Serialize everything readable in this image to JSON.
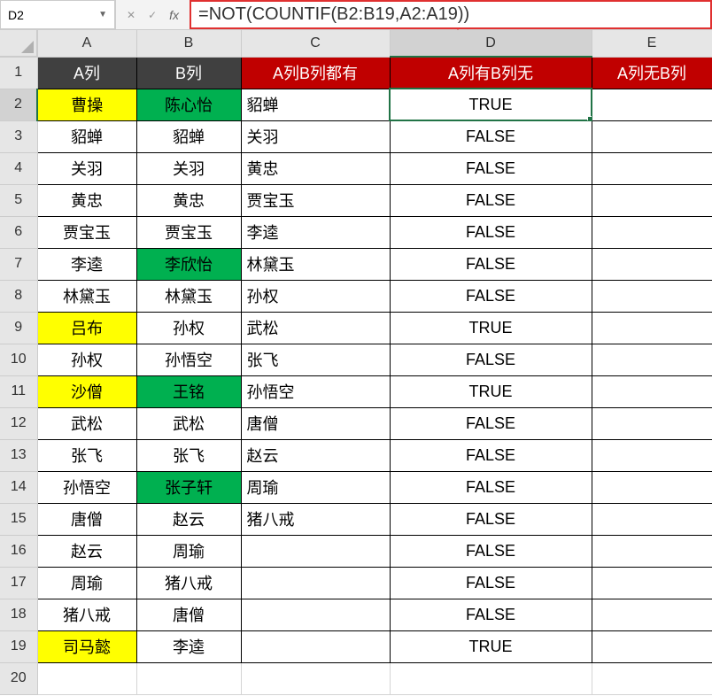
{
  "nameBox": "D2",
  "formula": "=NOT(COUNTIF(B2:B19,A2:A19))",
  "colHeaders": [
    "A",
    "B",
    "C",
    "D",
    "E"
  ],
  "activeCol": "D",
  "activeRow": 2,
  "fx": "fx",
  "headerRow": {
    "A": "A列",
    "B": "B列",
    "C": "A列B列都有",
    "D": "A列有B列无",
    "E": "A列无B列"
  },
  "rows": [
    {
      "r": 2,
      "A": {
        "v": "曹操",
        "cls": "yellow"
      },
      "B": {
        "v": "陈心怡",
        "cls": "green"
      },
      "C": {
        "v": "貂蝉"
      },
      "D": {
        "v": "TRUE"
      }
    },
    {
      "r": 3,
      "A": {
        "v": "貂蝉",
        "cls": "plain-center"
      },
      "B": {
        "v": "貂蝉",
        "cls": "plain-center"
      },
      "C": {
        "v": "关羽"
      },
      "D": {
        "v": "FALSE"
      }
    },
    {
      "r": 4,
      "A": {
        "v": "关羽",
        "cls": "plain-center"
      },
      "B": {
        "v": "关羽",
        "cls": "plain-center"
      },
      "C": {
        "v": "黄忠"
      },
      "D": {
        "v": "FALSE"
      }
    },
    {
      "r": 5,
      "A": {
        "v": "黄忠",
        "cls": "plain-center"
      },
      "B": {
        "v": "黄忠",
        "cls": "plain-center"
      },
      "C": {
        "v": "贾宝玉"
      },
      "D": {
        "v": "FALSE"
      }
    },
    {
      "r": 6,
      "A": {
        "v": "贾宝玉",
        "cls": "plain-center"
      },
      "B": {
        "v": "贾宝玉",
        "cls": "plain-center"
      },
      "C": {
        "v": "李逵"
      },
      "D": {
        "v": "FALSE"
      }
    },
    {
      "r": 7,
      "A": {
        "v": "李逵",
        "cls": "plain-center"
      },
      "B": {
        "v": "李欣怡",
        "cls": "green"
      },
      "C": {
        "v": "林黛玉"
      },
      "D": {
        "v": "FALSE"
      }
    },
    {
      "r": 8,
      "A": {
        "v": "林黛玉",
        "cls": "plain-center"
      },
      "B": {
        "v": "林黛玉",
        "cls": "plain-center"
      },
      "C": {
        "v": "孙权"
      },
      "D": {
        "v": "FALSE"
      }
    },
    {
      "r": 9,
      "A": {
        "v": "吕布",
        "cls": "yellow"
      },
      "B": {
        "v": "孙权",
        "cls": "plain-center"
      },
      "C": {
        "v": "武松"
      },
      "D": {
        "v": "TRUE"
      }
    },
    {
      "r": 10,
      "A": {
        "v": "孙权",
        "cls": "plain-center"
      },
      "B": {
        "v": "孙悟空",
        "cls": "plain-center"
      },
      "C": {
        "v": "张飞"
      },
      "D": {
        "v": "FALSE"
      }
    },
    {
      "r": 11,
      "A": {
        "v": "沙僧",
        "cls": "yellow"
      },
      "B": {
        "v": "王铭",
        "cls": "green"
      },
      "C": {
        "v": "孙悟空"
      },
      "D": {
        "v": "TRUE"
      }
    },
    {
      "r": 12,
      "A": {
        "v": "武松",
        "cls": "plain-center"
      },
      "B": {
        "v": "武松",
        "cls": "plain-center"
      },
      "C": {
        "v": "唐僧"
      },
      "D": {
        "v": "FALSE"
      }
    },
    {
      "r": 13,
      "A": {
        "v": "张飞",
        "cls": "plain-center"
      },
      "B": {
        "v": "张飞",
        "cls": "plain-center"
      },
      "C": {
        "v": "赵云"
      },
      "D": {
        "v": "FALSE"
      }
    },
    {
      "r": 14,
      "A": {
        "v": "孙悟空",
        "cls": "plain-center"
      },
      "B": {
        "v": "张子轩",
        "cls": "green"
      },
      "C": {
        "v": "周瑜"
      },
      "D": {
        "v": "FALSE"
      }
    },
    {
      "r": 15,
      "A": {
        "v": "唐僧",
        "cls": "plain-center"
      },
      "B": {
        "v": "赵云",
        "cls": "plain-center"
      },
      "C": {
        "v": "猪八戒"
      },
      "D": {
        "v": "FALSE"
      }
    },
    {
      "r": 16,
      "A": {
        "v": "赵云",
        "cls": "plain-center"
      },
      "B": {
        "v": "周瑜",
        "cls": "plain-center"
      },
      "C": {
        "v": ""
      },
      "D": {
        "v": "FALSE"
      }
    },
    {
      "r": 17,
      "A": {
        "v": "周瑜",
        "cls": "plain-center"
      },
      "B": {
        "v": "猪八戒",
        "cls": "plain-center"
      },
      "C": {
        "v": ""
      },
      "D": {
        "v": "FALSE"
      }
    },
    {
      "r": 18,
      "A": {
        "v": "猪八戒",
        "cls": "plain-center"
      },
      "B": {
        "v": "唐僧",
        "cls": "plain-center"
      },
      "C": {
        "v": ""
      },
      "D": {
        "v": "FALSE"
      }
    },
    {
      "r": 19,
      "A": {
        "v": "司马懿",
        "cls": "yellow"
      },
      "B": {
        "v": "李逵",
        "cls": "plain-center"
      },
      "C": {
        "v": ""
      },
      "D": {
        "v": "TRUE"
      }
    }
  ],
  "emptyRows": [
    20
  ]
}
